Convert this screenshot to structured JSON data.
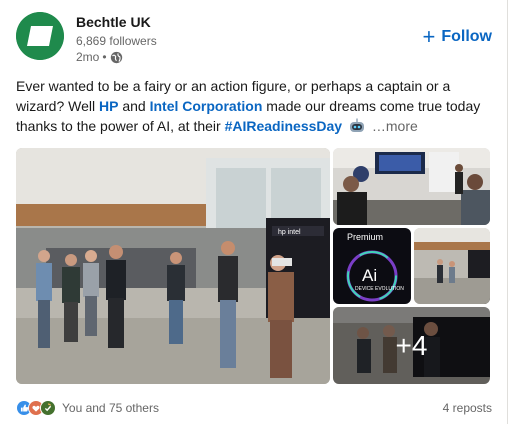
{
  "post": {
    "company": "Bechtle UK",
    "followers": "6,869 followers",
    "time": "2mo",
    "separator": "•",
    "follow_label": "Follow",
    "follow_symbol": "+",
    "text_1": "Ever wanted to be a fairy or an action figure, or perhaps a captain or a wizard? Well ",
    "mention_hp": "HP",
    "text_and": " and ",
    "mention_intel": "Intel Corporation",
    "text_2": " made our dreams come true today thanks to the power of AI, at their ",
    "hashtag": "#AIReadinessDay",
    "more_label": "…more",
    "extra_images": "+4",
    "photo_sign_hp": "hp intel",
    "photo_sign_premium": "Premium",
    "photo_sign_ai": "Ai",
    "photo_sign_ai_sub": "DEVICE EVOLUTION"
  },
  "social": {
    "reactions_text": "You and 75 others",
    "reposts": "4 reposts"
  },
  "colors": {
    "brand_green": "#1f8a4c",
    "link_blue": "#0a66c2",
    "secondary_text": "#666666"
  },
  "icons": [
    "globe-icon",
    "plus-icon",
    "like-reaction-icon",
    "love-reaction-icon",
    "insightful-reaction-icon",
    "robot-emoji-icon"
  ]
}
